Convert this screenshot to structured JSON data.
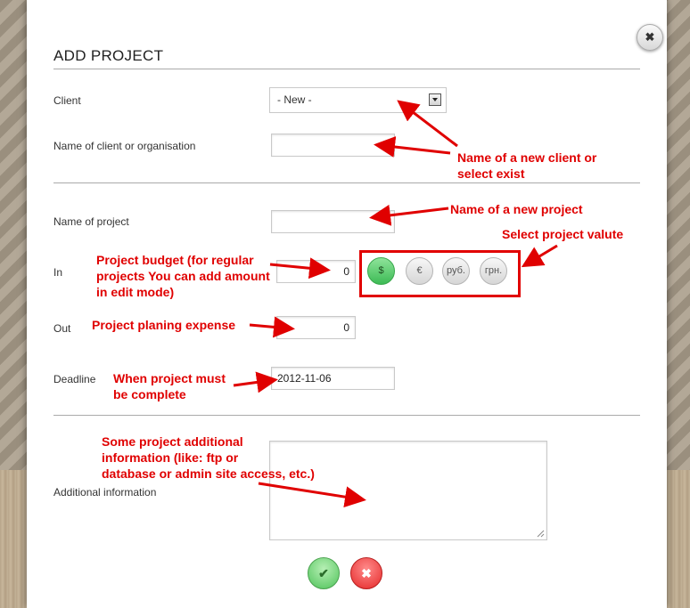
{
  "dialog": {
    "title": "ADD PROJECT",
    "close_label": "✖"
  },
  "form": {
    "client_label": "Client",
    "client_value": "- New -",
    "client_name_label": "Name of client or organisation",
    "client_name_value": "",
    "project_name_label": "Name of project",
    "project_name_value": "",
    "in_label": "In",
    "in_value": "0",
    "out_label": "Out",
    "out_value": "0",
    "deadline_label": "Deadline",
    "deadline_value": "2012-11-06",
    "additional_label": "Additional information",
    "additional_value": ""
  },
  "currencies": [
    {
      "label": "$",
      "active": true
    },
    {
      "label": "€",
      "active": false
    },
    {
      "label": "руб.",
      "active": false
    },
    {
      "label": "грн.",
      "active": false
    }
  ],
  "actions": {
    "ok_label": "✔",
    "cancel_label": "✖"
  },
  "annotations": {
    "client_note": "Name of a new client or\nselect exist",
    "project_note": "Name of a new project",
    "valute_note": "Select project valute",
    "budget_note": "Project budget (for regular\nprojects You can add amount\nin edit mode)",
    "expense_note": "Project planing expense",
    "deadline_note": "When project must\nbe complete",
    "info_note": "Some project additional\ninformation (like: ftp or\ndatabase or admin site access, etc.)"
  },
  "colors": {
    "annotation": "#e00000",
    "active_currency": "#3dbb55",
    "ok": "#4fc35a",
    "cancel": "#e52828"
  }
}
